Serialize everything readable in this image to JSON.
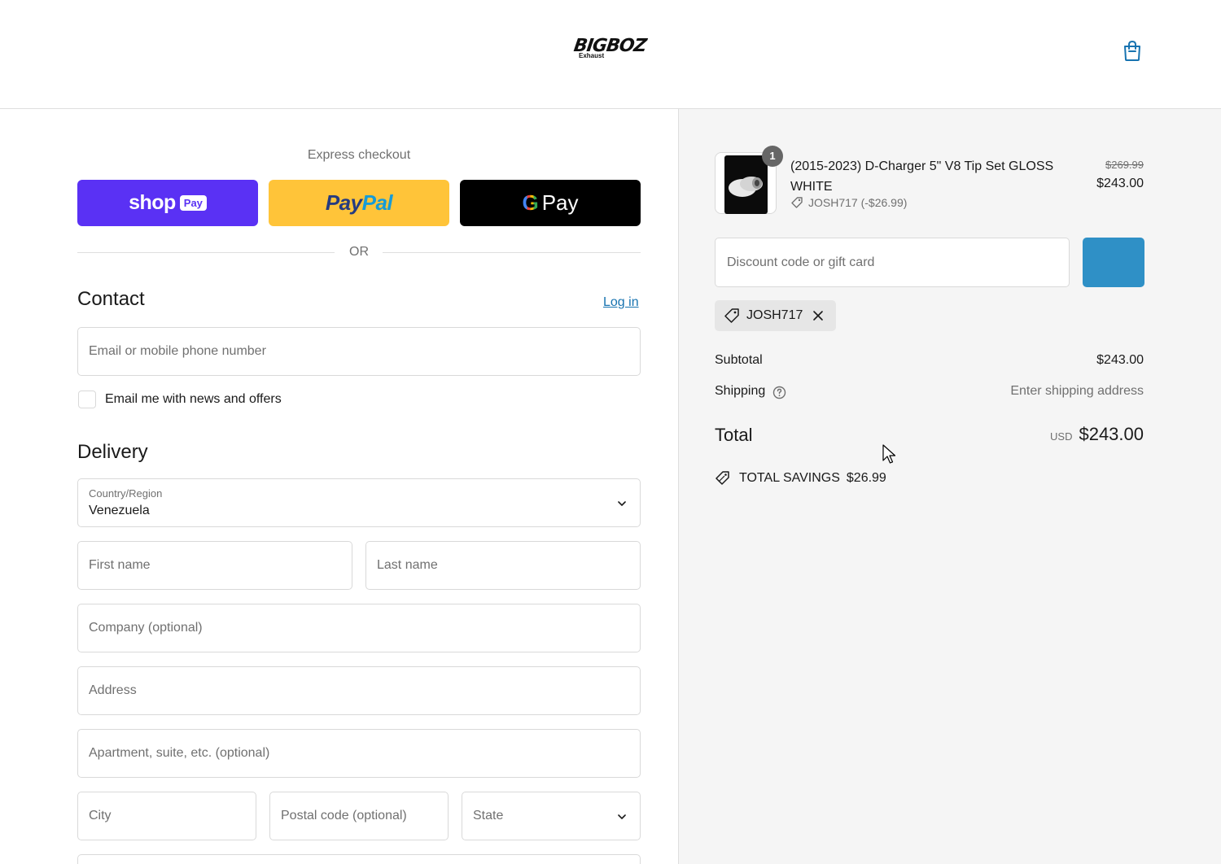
{
  "brand": {
    "logo_text": "BIGBOZ",
    "logo_sub": "Exhaust"
  },
  "express": {
    "title": "Express checkout",
    "shop_pay": {
      "word": "shop",
      "badge": "Pay"
    },
    "paypal": {
      "part1": "Pay",
      "part2": "Pal"
    },
    "gpay": {
      "g": "G",
      "word": "Pay"
    },
    "or": "OR"
  },
  "contact": {
    "title": "Contact",
    "login": "Log in",
    "email_placeholder": "Email or mobile phone number",
    "newsletter_label": "Email me with news and offers"
  },
  "delivery": {
    "title": "Delivery",
    "country_label": "Country/Region",
    "country_value": "Venezuela",
    "first_name": "First name",
    "last_name": "Last name",
    "company": "Company (optional)",
    "address": "Address",
    "apartment": "Apartment, suite, etc. (optional)",
    "city": "City",
    "postal": "Postal code (optional)",
    "state": "State"
  },
  "summary": {
    "item": {
      "quantity": "1",
      "name": "(2015-2023) D-Charger 5\" V8 Tip Set GLOSS WHITE",
      "discount": "JOSH717 (-$26.99)",
      "price_original": "$269.99",
      "price_final": "$243.00"
    },
    "discount_placeholder": "Discount code or gift card",
    "applied_code": "JOSH717",
    "subtotal_label": "Subtotal",
    "subtotal_value": "$243.00",
    "shipping_label": "Shipping",
    "shipping_value": "Enter shipping address",
    "total_label": "Total",
    "total_currency": "USD",
    "total_value": "$243.00",
    "savings_label": "TOTAL SAVINGS",
    "savings_value": "$26.99"
  },
  "colors": {
    "shop_pay": "#5a31f4",
    "paypal": "#ffc439",
    "gpay": "#000000",
    "link": "#1773b0",
    "apply_button": "#2f90c6"
  }
}
